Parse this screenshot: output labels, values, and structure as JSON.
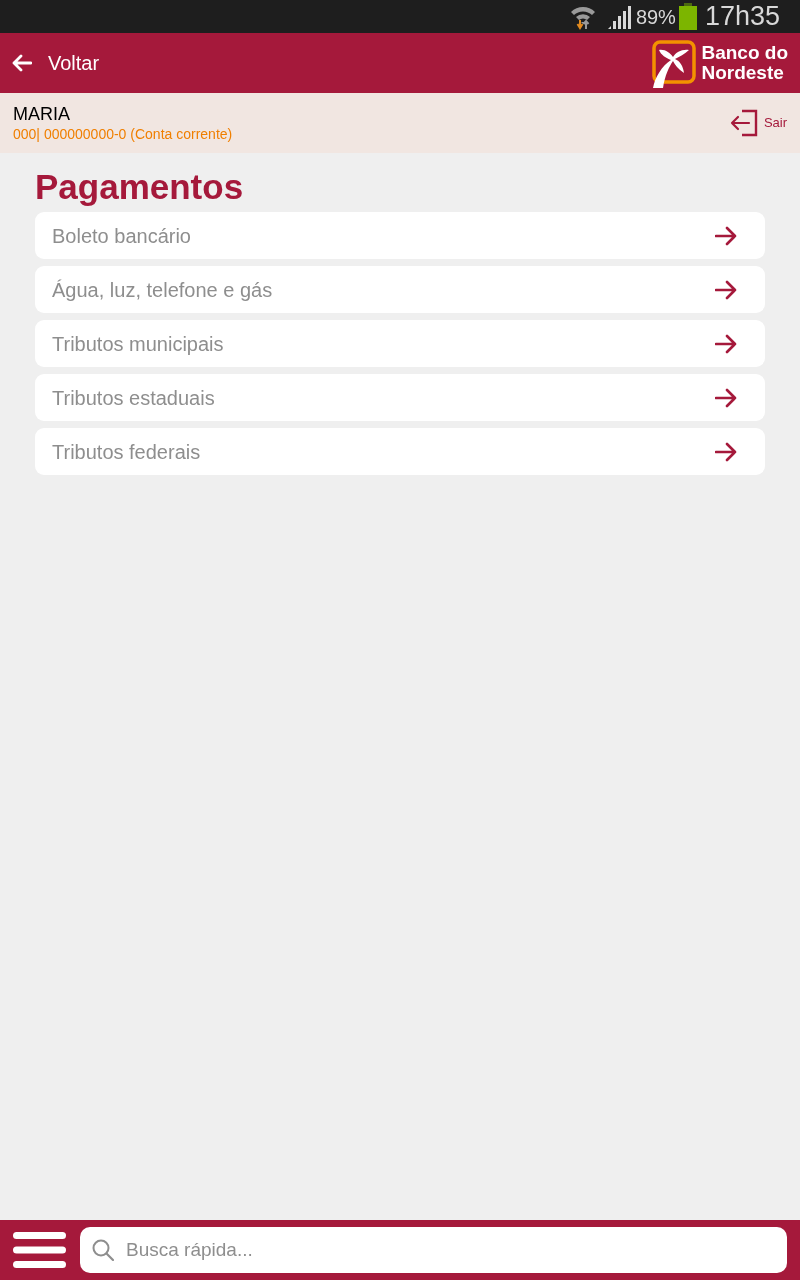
{
  "status_bar": {
    "battery_text": "89%",
    "time": "17h35"
  },
  "header": {
    "back_label": "Voltar",
    "logo_lines": [
      "Banco do",
      "Nordeste"
    ]
  },
  "account": {
    "name": "MARIA",
    "detail": "000| 000000000-0 (Conta corrente)",
    "logout_label": "Sair"
  },
  "page_title": "Pagamentos",
  "menu_items": [
    {
      "label": "Boleto bancário"
    },
    {
      "label": "Água, luz, telefone e gás"
    },
    {
      "label": "Tributos municipais"
    },
    {
      "label": "Tributos estaduais"
    },
    {
      "label": "Tributos federais"
    }
  ],
  "bottom_bar": {
    "search": {
      "placeholder": "Busca rápida..."
    }
  }
}
